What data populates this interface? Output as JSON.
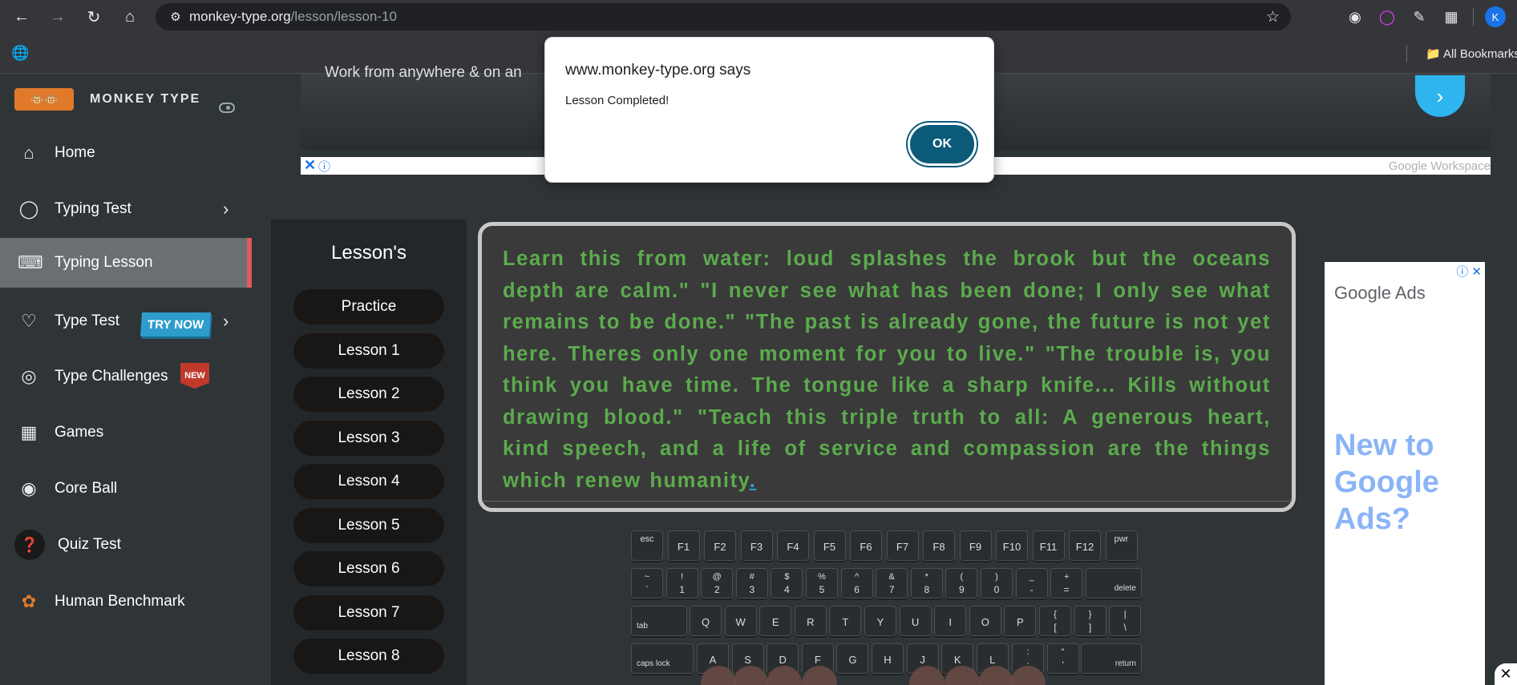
{
  "browser": {
    "url_domain": "monkey-type.org",
    "url_path": "/lesson/lesson-10",
    "bookmarks_label": "All Bookmarks",
    "profile_initial": "K"
  },
  "sidebar": {
    "brand": "MONKEY TYPE",
    "items": [
      {
        "label": "Home",
        "icon": "home-icon"
      },
      {
        "label": "Typing Test",
        "icon": "github-icon"
      },
      {
        "label": "Typing Lesson",
        "icon": "keyboard-icon"
      },
      {
        "label": "Type Test",
        "icon": "cat-icon",
        "badge": "TRY NOW"
      },
      {
        "label": "Type Challenges",
        "icon": "award-icon",
        "badge": "NEW"
      },
      {
        "label": "Games",
        "icon": "grid-icon"
      },
      {
        "label": "Core Ball",
        "icon": "target-icon"
      },
      {
        "label": "Quiz Test",
        "icon": "quiz-icon"
      },
      {
        "label": "Human Benchmark",
        "icon": "brain-icon"
      }
    ]
  },
  "ad_top": {
    "text": "Work from anywhere & on an",
    "label": "Google Workspace"
  },
  "lessons": {
    "title": "Lesson's",
    "items": [
      "Practice",
      "Lesson 1",
      "Lesson 2",
      "Lesson 3",
      "Lesson 4",
      "Lesson 5",
      "Lesson 6",
      "Lesson 7",
      "Lesson 8"
    ]
  },
  "lesson_text": {
    "body": "Learn this from water: loud splashes the brook but the oceans depth are calm.\" \"I never see what has been done; I only see what remains to be done.\" \"The past is already gone, the future is not yet here. Theres only one moment for you to live.\" \"The trouble is, you think you have time. The tongue like a sharp knife... Kills without drawing blood.\" \"Teach this triple truth to all: A generous heart, kind speech, and a life of service and compassion are the things which renew humanity",
    "cursor": "."
  },
  "keyboard": {
    "row0": [
      "esc",
      "F1",
      "F2",
      "F3",
      "F4",
      "F5",
      "F6",
      "F7",
      "F8",
      "F9",
      "F10",
      "F11",
      "F12",
      "pwr"
    ],
    "row1_top": [
      "~",
      "!",
      "@",
      "#",
      "$",
      "%",
      "^",
      "&",
      "*",
      "(",
      ")",
      "_",
      "+"
    ],
    "row1_bottom": [
      "`",
      "1",
      "2",
      "3",
      "4",
      "5",
      "6",
      "7",
      "8",
      "9",
      "0",
      "-",
      "="
    ],
    "row1_delete": "delete",
    "row2_tab": "tab",
    "row2": [
      "Q",
      "W",
      "E",
      "R",
      "T",
      "Y",
      "U",
      "I",
      "O",
      "P"
    ],
    "row2_sym_top": [
      "{",
      "}",
      "|"
    ],
    "row2_sym_bottom": [
      "[",
      "]",
      "\\"
    ],
    "row3_caps": "caps lock",
    "row3": [
      "A",
      "S",
      "D",
      "F",
      "G",
      "H",
      "J",
      "K",
      "L"
    ],
    "row3_sym_top": [
      ":",
      "\""
    ],
    "row3_sym_bottom": [
      ";",
      "'"
    ],
    "row3_return": "return"
  },
  "right_ad": {
    "logo": "Google Ads",
    "headline": "New to Google Ads?"
  },
  "dialog": {
    "title": "www.monkey-type.org says",
    "message": "Lesson Completed!",
    "ok": "OK"
  }
}
